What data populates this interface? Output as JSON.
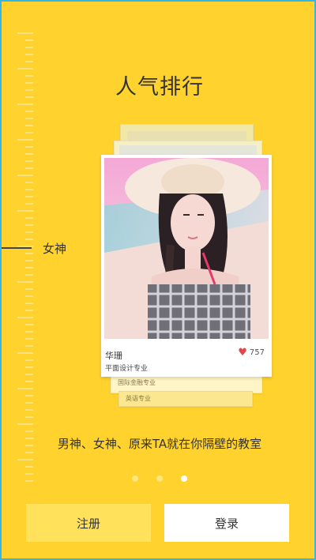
{
  "title": "人气排行",
  "ruler": {
    "label": "女神"
  },
  "featured_card": {
    "name": "华珊",
    "major": "平面设计专业",
    "likes": "757"
  },
  "back_cards": [
    {
      "label": "国际金融专业"
    },
    {
      "label": "英语专业"
    }
  ],
  "tagline": "男神、女神、原来TA就在你隔壁的教室",
  "pager": {
    "count": 3,
    "active_index": 2
  },
  "buttons": {
    "register_label": "注册",
    "login_label": "登录"
  },
  "colors": {
    "background": "#FFD22E",
    "heart": "#E5454A",
    "frame": "#37B5E6"
  }
}
